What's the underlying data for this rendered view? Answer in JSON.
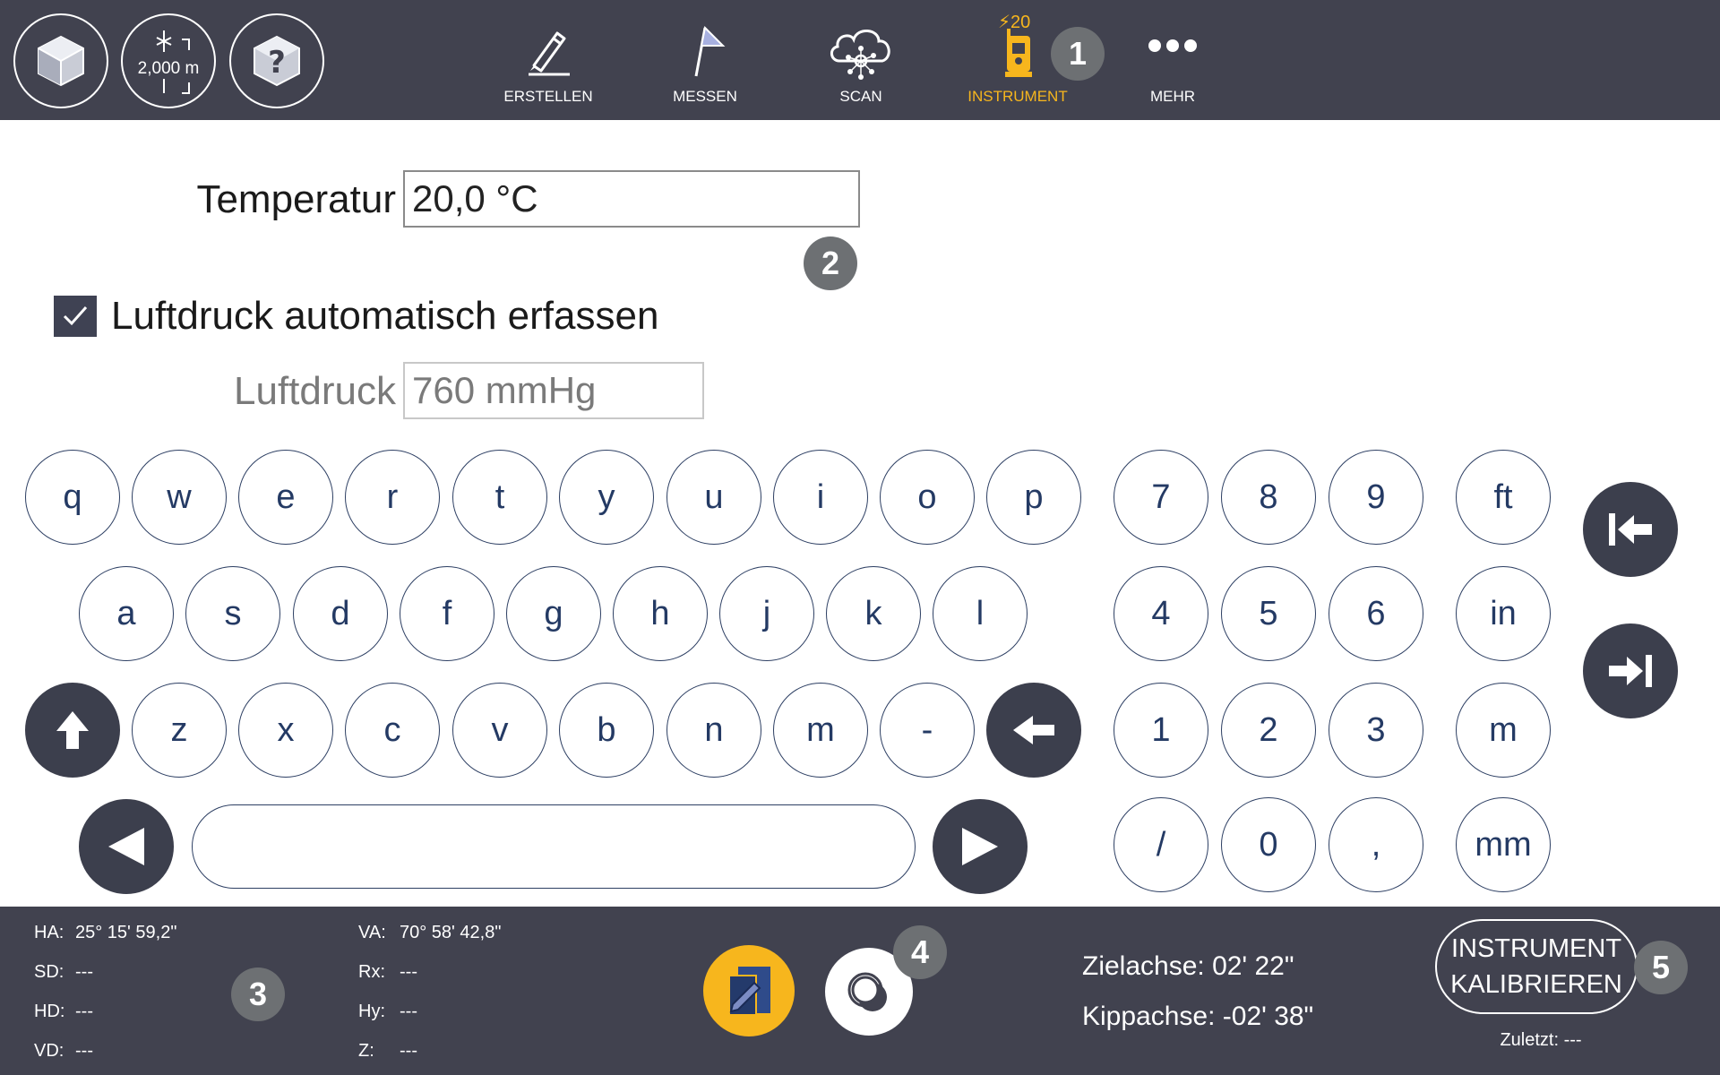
{
  "topbar": {
    "scale_label": "2,000 m",
    "battery_level": "20",
    "nav": [
      {
        "label": "ERSTELLEN",
        "icon": "pencil-icon"
      },
      {
        "label": "MESSEN",
        "icon": "flag-icon"
      },
      {
        "label": "SCAN",
        "icon": "cloud-scan-icon"
      },
      {
        "label": "INSTRUMENT",
        "icon": "total-station-icon",
        "active": true
      },
      {
        "label": "MEHR",
        "icon": "more-dots-icon"
      }
    ]
  },
  "callouts": [
    "1",
    "2",
    "3",
    "4",
    "5"
  ],
  "form": {
    "temperature_label": "Temperatur",
    "temperature_value": "20,0 °C",
    "auto_pressure_label": "Luftdruck automatisch erfassen",
    "auto_pressure_checked": true,
    "pressure_label": "Luftdruck",
    "pressure_value": "760 mmHg"
  },
  "keyboard": {
    "row1": [
      "q",
      "w",
      "e",
      "r",
      "t",
      "y",
      "u",
      "i",
      "o",
      "p"
    ],
    "row2": [
      "a",
      "s",
      "d",
      "f",
      "g",
      "h",
      "j",
      "k",
      "l"
    ],
    "row3": [
      "z",
      "x",
      "c",
      "v",
      "b",
      "n",
      "m",
      "-"
    ],
    "numpad": [
      [
        "7",
        "8",
        "9"
      ],
      [
        "4",
        "5",
        "6"
      ],
      [
        "1",
        "2",
        "3"
      ],
      [
        "/",
        "0",
        ","
      ]
    ],
    "units": [
      "ft",
      "in",
      "m",
      "mm"
    ]
  },
  "status": {
    "left": [
      {
        "key": "HA:",
        "value": "25° 15' 59,2\""
      },
      {
        "key": "SD:",
        "value": "---"
      },
      {
        "key": "HD:",
        "value": "---"
      },
      {
        "key": "VD:",
        "value": "---"
      }
    ],
    "right": [
      {
        "key": "VA:",
        "value": "70° 58' 42,8\""
      },
      {
        "key": "Rx:",
        "value": "---"
      },
      {
        "key": "Hy:",
        "value": "---"
      },
      {
        "key": "Z:",
        "value": "---"
      }
    ],
    "zielachse": "Zielachse:  02' 22\"",
    "kippachse": "Kippachse:  -02' 38\"",
    "calibrate_line1": "INSTRUMENT",
    "calibrate_line2": "KALIBRIEREN",
    "last": "Zuletzt: ---"
  },
  "colors": {
    "bar_bg": "#41424f",
    "accent": "#f7b61d",
    "key_text": "#243a64",
    "key_dark": "#3c3f4d",
    "callout": "#6d7073"
  }
}
